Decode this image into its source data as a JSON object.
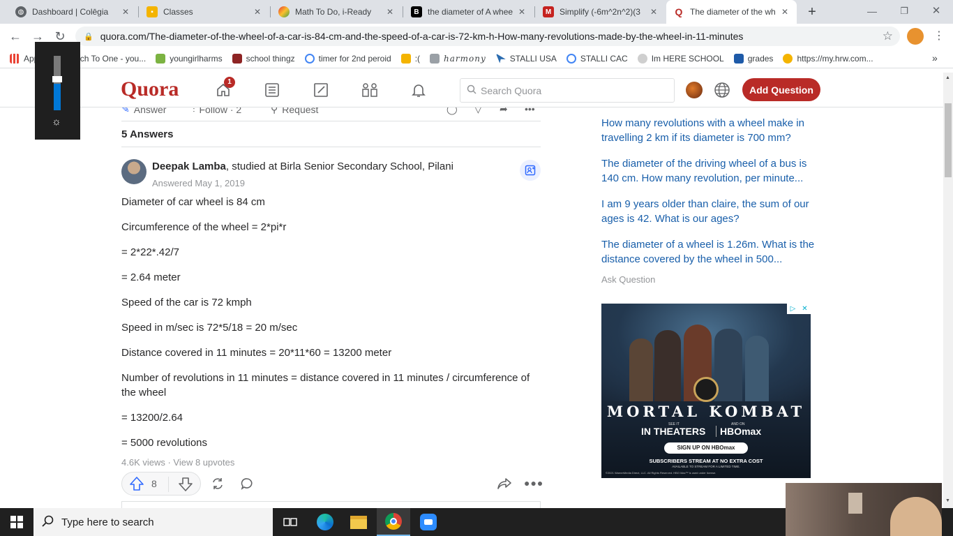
{
  "browser": {
    "tabs": [
      {
        "title": "Dashboard | Colēgia",
        "icon": "globe-icon",
        "color": "#5f6368"
      },
      {
        "title": "Classes",
        "icon": "classroom-icon",
        "color": "#f4b400"
      },
      {
        "title": "Math To Do, i-Ready",
        "icon": "iready-icon",
        "color": "#e53935"
      },
      {
        "title": "the diameter of A whee",
        "icon": "brainly-icon",
        "color": "#000000"
      },
      {
        "title": "Simplify (-6m^2n^2)(3",
        "icon": "gmail-icon",
        "color": "#c5221f"
      },
      {
        "title": "The diameter of the wh",
        "icon": "quora-icon",
        "color": "#b92b27"
      }
    ],
    "new_tab": "+",
    "url": "quora.com/The-diameter-of-the-wheel-of-a-car-is-84-cm-and-the-speed-of-a-car-is-72-km-h-How-many-revolutions-made-by-the-wheel-in-11-minutes",
    "bookmarks": [
      {
        "label": "Apps",
        "color": "#4285f4"
      },
      {
        "label": "Teach To One - you...",
        "color": "#00897b"
      },
      {
        "label": "youngirlharms",
        "color": "#7cb342"
      },
      {
        "label": "school thingz",
        "color": "#8e2424"
      },
      {
        "label": "timer for 2nd peroid",
        "color": "#4285f4"
      },
      {
        "label": ":(",
        "color": "#f4b400"
      },
      {
        "label": "harmony",
        "color": "#5f6368"
      },
      {
        "label": "STALLI USA",
        "color": "#2b6cb0"
      },
      {
        "label": "STALLI CAC",
        "color": "#4285f4"
      },
      {
        "label": "Im HERE SCHOOL",
        "color": "#cfcfcf"
      },
      {
        "label": "grades",
        "color": "#1e5aa8"
      },
      {
        "label": "https://my.hrw.com...",
        "color": "#f4b400"
      }
    ],
    "more_bookmarks": "»"
  },
  "quora": {
    "logo": "Quora",
    "notification_count": "1",
    "search_placeholder": "Search Quora",
    "add_question": "Add Question",
    "question_actions": {
      "answer": "Answer",
      "follow": "Follow · 2",
      "request": "Request"
    },
    "answer_count": "5 Answers",
    "answer": {
      "author": "Deepak Lamba",
      "credential": ", studied at Birla Senior Secondary School, Pilani",
      "date": "Answered May 1, 2019",
      "lines": [
        "Diameter of car wheel is 84 cm",
        "Circumference of the wheel = 2*pi*r",
        "= 2*22*.42/7",
        "= 2.64 meter",
        "Speed of the car is 72 kmph",
        "Speed in m/sec is 72*5/18 = 20 m/sec",
        "Distance covered in 11 minutes = 20*11*60 = 13200 meter",
        "Number of revolutions in 11 minutes = distance covered in 11 minutes / circumference of the wheel",
        "= 13200/2.64",
        "= 5000 revolutions"
      ],
      "stats": "4.6K views · View 8 upvotes",
      "upvotes": "8"
    },
    "related": [
      "How many revolutions with a wheel make in travelling 2 km if its diameter is 700 mm?",
      "The diameter of the driving wheel of a bus is 140 cm. How many revolution, per minute...",
      "I am 9 years older than claire, the sum of our ages is 42. What is our ages?",
      "The diameter of a wheel is 1.26m. What is the distance covered by the wheel in 500..."
    ],
    "ask_question": "Ask Question",
    "ad": {
      "title": "MORTAL KOMBAT",
      "see_it": "SEE IT",
      "and_on": "AND ON",
      "in_theaters": "IN THEATERS",
      "hbomax": "HBOmax",
      "signup": "SIGN UP ON HBOmax",
      "subscribers": "SUBSCRIBERS STREAM AT NO EXTRA COST",
      "available": "AVAILABLE TO STREAM FOR A LIMITED TIME.",
      "legal": "©2021 WarnerMedia Direct, LLC. All Rights Reserved. HBO Max™ is used under license."
    }
  },
  "taskbar": {
    "search_placeholder": "Type here to search"
  }
}
